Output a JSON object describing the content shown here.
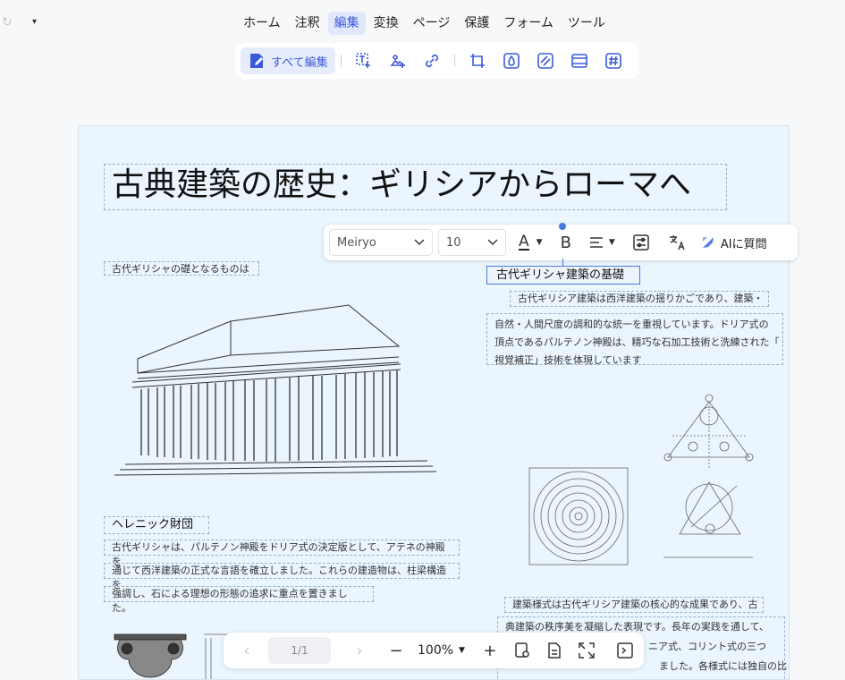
{
  "quick_access": {
    "undo_glyph": "↻",
    "caret": "▾"
  },
  "menu": [
    "ホーム",
    "注釈",
    "編集",
    "変換",
    "ページ",
    "保護",
    "フォーム",
    "ツール"
  ],
  "ribbon": {
    "edit_all_label": "すべて編集"
  },
  "document": {
    "title": "古典建築の歴史：ギリシアからローマへ",
    "caption_left": "古代ギリシャの礎となるものは",
    "heading_right": "古代ギリシャ建築の基礎",
    "para_right_line1": "古代ギリシア建築は西洋建築の揺りかごであり、建築・",
    "para_right_lines": [
      "自然・人間尺度の調和的な統一を重視しています。ドリア式の",
      "頂点であるパルテノン神殿は、精巧な石加工技術と洗練された「",
      "視覚補正」技術を体現しています"
    ],
    "heading_left2": "ヘレニック財団",
    "para_left_lines": [
      "古代ギリシャは、パルテノン神殿をドリア式の決定版として、アテネの神殿を",
      "通じて西洋建築の正式な言語を確立しました。これらの建造物は、柱梁構造を",
      "強調し、石による理想の形態の追求に重点を置きました。"
    ],
    "para_bottom_line1": "建築様式は古代ギリシア建築の核心的な成果であり、古",
    "para_bottom_lines": [
      "典建築の秩序美を凝縮した表現です。長年の実践を通して、",
      "ニア式、コリント式の三つ",
      "ました。各様式には独自の比"
    ]
  },
  "format_toolbar": {
    "font": "Meiryo",
    "size": "10",
    "ai_label": "AIに質問",
    "text_glyph": "A",
    "bold_glyph": "B",
    "accent": "#3a5bd9"
  },
  "nav": {
    "page": "1/1",
    "zoom": "100%"
  },
  "icons": [
    "edit-all-icon",
    "text-edit-icon",
    "image-icon",
    "link-icon",
    "crop-icon",
    "watermark-icon",
    "background-icon",
    "header-footer-icon",
    "bates-icon"
  ]
}
